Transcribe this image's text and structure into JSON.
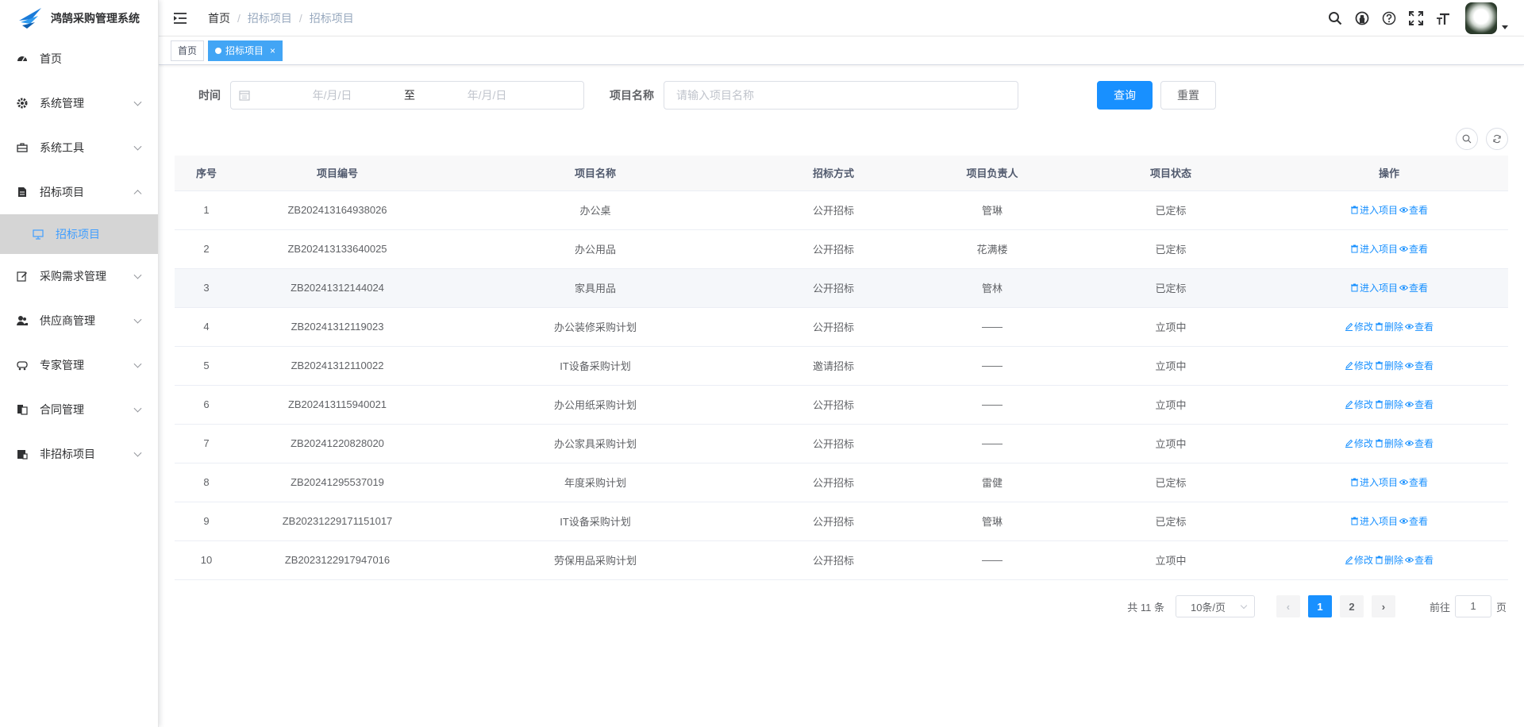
{
  "app": {
    "title": "鸿鹄采购管理系统"
  },
  "sidebar": {
    "items": [
      {
        "label": "首页",
        "icon": "dashboard-icon",
        "expandable": false
      },
      {
        "label": "系统管理",
        "icon": "gear-icon",
        "expandable": true
      },
      {
        "label": "系统工具",
        "icon": "toolbox-icon",
        "expandable": true
      },
      {
        "label": "招标项目",
        "icon": "document-icon",
        "expandable": true,
        "expanded": true
      },
      {
        "label": "采购需求管理",
        "icon": "edit-icon",
        "expandable": true
      },
      {
        "label": "供应商管理",
        "icon": "users-icon",
        "expandable": true
      },
      {
        "label": "专家管理",
        "icon": "expert-icon",
        "expandable": true
      },
      {
        "label": "合同管理",
        "icon": "contract-icon",
        "expandable": true
      },
      {
        "label": "非招标项目",
        "icon": "folder-icon",
        "expandable": true
      }
    ],
    "active_sub": {
      "label": "招标项目",
      "icon": "monitor-icon"
    }
  },
  "header": {
    "breadcrumb": [
      "首页",
      "招标项目",
      "招标项目"
    ],
    "icons": [
      "search-icon",
      "github-icon",
      "help-icon",
      "fullscreen-icon",
      "font-size-icon"
    ]
  },
  "tags": {
    "home": "首页",
    "active": "招标项目",
    "close": "×"
  },
  "search": {
    "time_label": "时间",
    "date_start_placeholder": "年/月/日",
    "date_separator": "至",
    "date_end_placeholder": "年/月/日",
    "name_label": "项目名称",
    "name_placeholder": "请输入项目名称",
    "query_button": "查询",
    "reset_button": "重置"
  },
  "table": {
    "headers": [
      "序号",
      "项目编号",
      "项目名称",
      "招标方式",
      "项目负责人",
      "项目状态",
      "操作"
    ],
    "rows": [
      {
        "no": "1",
        "code": "ZB202413164938026",
        "name": "办公桌",
        "method": "公开招标",
        "owner": "管琳",
        "status": "已定标",
        "ops": [
          "进入项目",
          "查看"
        ]
      },
      {
        "no": "2",
        "code": "ZB202413133640025",
        "name": "办公用品",
        "method": "公开招标",
        "owner": "花满楼",
        "status": "已定标",
        "ops": [
          "进入项目",
          "查看"
        ]
      },
      {
        "no": "3",
        "code": "ZB20241312144024",
        "name": "家具用品",
        "method": "公开招标",
        "owner": "管林",
        "status": "已定标",
        "ops": [
          "进入项目",
          "查看"
        ]
      },
      {
        "no": "4",
        "code": "ZB20241312119023",
        "name": "办公装修采购计划",
        "method": "公开招标",
        "owner": "——",
        "status": "立项中",
        "ops": [
          "修改",
          "删除",
          "查看"
        ]
      },
      {
        "no": "5",
        "code": "ZB20241312110022",
        "name": "IT设备采购计划",
        "method": "邀请招标",
        "owner": "——",
        "status": "立项中",
        "ops": [
          "修改",
          "删除",
          "查看"
        ]
      },
      {
        "no": "6",
        "code": "ZB202413115940021",
        "name": "办公用纸采购计划",
        "method": "公开招标",
        "owner": "——",
        "status": "立项中",
        "ops": [
          "修改",
          "删除",
          "查看"
        ]
      },
      {
        "no": "7",
        "code": "ZB20241220828020",
        "name": "办公家具采购计划",
        "method": "公开招标",
        "owner": "——",
        "status": "立项中",
        "ops": [
          "修改",
          "删除",
          "查看"
        ]
      },
      {
        "no": "8",
        "code": "ZB20241295537019",
        "name": "年度采购计划",
        "method": "公开招标",
        "owner": "雷健",
        "status": "已定标",
        "ops": [
          "进入项目",
          "查看"
        ]
      },
      {
        "no": "9",
        "code": "ZB20231229171151017",
        "name": "IT设备采购计划",
        "method": "公开招标",
        "owner": "管琳",
        "status": "已定标",
        "ops": [
          "进入项目",
          "查看"
        ]
      },
      {
        "no": "10",
        "code": "ZB2023122917947016",
        "name": "劳保用品采购计划",
        "method": "公开招标",
        "owner": "——",
        "status": "立项中",
        "ops": [
          "修改",
          "删除",
          "查看"
        ]
      }
    ]
  },
  "pagination": {
    "total": "共 11 条",
    "page_size": "10条/页",
    "pages": [
      "1",
      "2"
    ],
    "current": "1",
    "goto_label": "前往",
    "goto_value": "1",
    "goto_suffix": "页"
  },
  "colors": {
    "primary": "#1890ff",
    "tag_active": "#42a5f5",
    "submenu_bg": "#d5d5d5"
  }
}
